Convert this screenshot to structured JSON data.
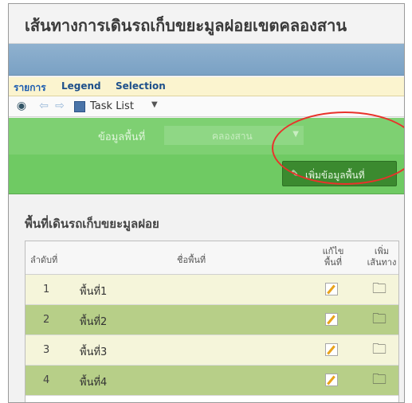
{
  "app": {
    "title": "เส้นทางการเดินรถเก็บขยะมูลฝอยเขตคลองสาน"
  },
  "tabs": [
    {
      "label": "รายการ"
    },
    {
      "label": "Legend"
    },
    {
      "label": "Selection"
    }
  ],
  "toolbar": {
    "task_list_label": "Task List"
  },
  "filter": {
    "label": "ข้อมูลพื้นที่",
    "selected_value": "คลองสาน"
  },
  "actions": {
    "add_area_label": "เพิ่มข้อมูลพื้นที่"
  },
  "section": {
    "title": "พื้นที่เดินรถเก็บขยะมูลฝอย"
  },
  "table": {
    "headers": {
      "no": "ลำดับที่",
      "name": "ชื่อพื้นที่",
      "edit_line1": "แก้ไข",
      "edit_line2": "พื้นที่",
      "route_line1": "เพิ่ม",
      "route_line2": "เส้นทาง"
    },
    "rows": [
      {
        "no": "1",
        "name": "พื้นที่1"
      },
      {
        "no": "2",
        "name": "พื้นที่2"
      },
      {
        "no": "3",
        "name": "พื้นที่3"
      },
      {
        "no": "4",
        "name": "พื้นที่4"
      }
    ]
  },
  "icons": {
    "toolbar": [
      "globe-icon",
      "back-arrow-icon",
      "forward-arrow-icon",
      "task-list-icon",
      "chevron-down-icon"
    ],
    "row_actions": [
      "edit-icon",
      "add-route-icon"
    ]
  },
  "colors": {
    "header_blue": "#7aa1c4",
    "filter_green": "#7ed072",
    "button_green": "#3b8a2f",
    "row_odd": "#f5f5da",
    "row_even": "#b7cf88",
    "highlight_red": "#e9322b"
  }
}
